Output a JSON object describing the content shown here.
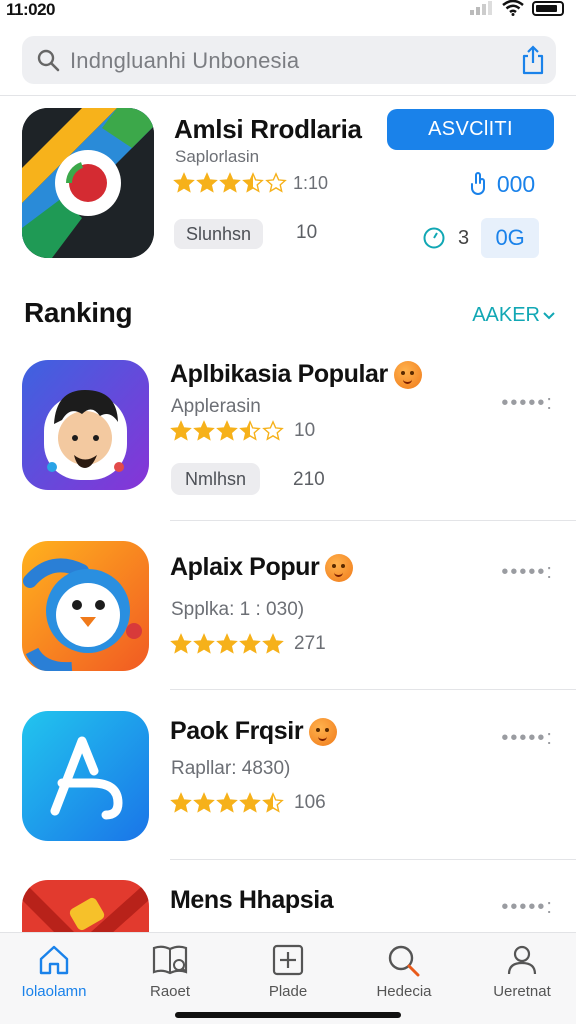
{
  "status_bar": {
    "time": "11:020"
  },
  "search": {
    "text": "Indngluanhi Unbonesia"
  },
  "featured": {
    "title": "Amlsi Rrodlaria",
    "subtitle": "Saplorlasin",
    "rating_value": "1:10",
    "stars": 3.5,
    "pill": "Slunhsn",
    "pill_count": "10",
    "action_label": "ASVClITI",
    "stat_value": "000",
    "meta_value": "3",
    "meta_box": "0G"
  },
  "ranking": {
    "title": "Ranking",
    "link_label": "AAKER",
    "items": [
      {
        "name": "Aplbikasia Popular",
        "sub": "Applerasin",
        "rating_value": "10",
        "stars": 3.5,
        "pill": "Nmlhsn",
        "pill_count": "210",
        "more": "•••••:"
      },
      {
        "name": "Aplaix Popur",
        "sub": "Spplka: 1 : 030)",
        "rating_value": "271",
        "stars": 5,
        "more": "•••••:"
      },
      {
        "name": "Paok Frqsir",
        "sub": "Rapllar: 4830)",
        "rating_value": "106",
        "stars": 4.5,
        "more": "•••••:"
      },
      {
        "name": "Mens Hhapsia",
        "sub": "",
        "more": "•••••:"
      }
    ]
  },
  "tabs": [
    {
      "label": "Iolaolamn",
      "icon": "home-icon",
      "active": true
    },
    {
      "label": "Raoet",
      "icon": "book-icon",
      "active": false
    },
    {
      "label": "Plade",
      "icon": "plus-square-icon",
      "active": false
    },
    {
      "label": "Hedecia",
      "icon": "search-icon",
      "active": false
    },
    {
      "label": "Ueretnat",
      "icon": "person-icon",
      "active": false
    }
  ],
  "colors": {
    "accent": "#1a82ea",
    "teal_link": "#11a7b4",
    "star": "#f6b11a"
  }
}
